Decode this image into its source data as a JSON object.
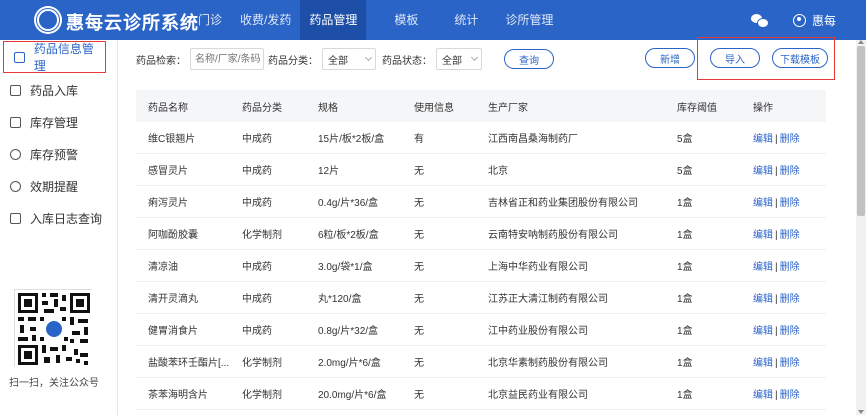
{
  "app": {
    "title": "惠每云诊所系统"
  },
  "nav": [
    {
      "label": "门诊"
    },
    {
      "label": "收费/发药"
    },
    {
      "label": "药品管理"
    },
    {
      "label": "模板"
    },
    {
      "label": "统计"
    },
    {
      "label": "诊所管理"
    }
  ],
  "header_right": {
    "user_name": "惠每"
  },
  "sidebar": {
    "items": [
      {
        "label": "药品信息管理",
        "icon": "file-icon"
      },
      {
        "label": "药品入库",
        "icon": "inbox-icon"
      },
      {
        "label": "库存管理",
        "icon": "box-icon"
      },
      {
        "label": "库存预警",
        "icon": "bell-icon"
      },
      {
        "label": "效期提醒",
        "icon": "clock-icon"
      },
      {
        "label": "入库日志查询",
        "icon": "log-icon"
      }
    ],
    "qr_caption": "扫一扫，关注公众号"
  },
  "toolbar": {
    "search_label": "药品检索：",
    "search_placeholder": "名称/厂家/条码",
    "category_label": "药品分类：",
    "category_value": "全部",
    "status_label": "药品状态：",
    "status_value": "全部",
    "query_button": "查询",
    "add_button": "新增",
    "import_button": "导入",
    "download_button": "下载模板"
  },
  "table": {
    "headers": [
      "药品名称",
      "药品分类",
      "规格",
      "使用信息",
      "生产厂家",
      "库存阈值",
      "操作"
    ],
    "rows": [
      [
        "维C银翘片",
        "中成药",
        "15片/板*2板/盒",
        "有",
        "江西南昌桑海制药厂",
        "5盒"
      ],
      [
        "感冒灵片",
        "中成药",
        "12片",
        "无",
        "北京",
        "5盒"
      ],
      [
        "痢泻灵片",
        "中成药",
        "0.4g/片*36/盒",
        "无",
        "吉林省正和药业集团股份有限公司",
        "1盒"
      ],
      [
        "阿咖酚胶囊",
        "化学制剂",
        "6粒/板*2板/盒",
        "无",
        "云南特安呐制药股份有限公司",
        "1盒"
      ],
      [
        "清凉油",
        "中成药",
        "3.0g/袋*1/盒",
        "无",
        "上海中华药业有限公司",
        "1盒"
      ],
      [
        "清开灵滴丸",
        "中成药",
        "丸*120/盒",
        "无",
        "江苏正大清江制药有限公司",
        "1盒"
      ],
      [
        "健胃消食片",
        "中成药",
        "0.8g/片*32/盒",
        "无",
        "江中药业股份有限公司",
        "1盒"
      ],
      [
        "盐酸苯环壬酯片[...",
        "化学制剂",
        "2.0mg/片*6/盒",
        "无",
        "北京华素制药股份有限公司",
        "1盒"
      ],
      [
        "茶苯海明含片",
        "化学制剂",
        "20.0mg/片*6/盒",
        "无",
        "北京益民药业有限公司",
        "1盒"
      ]
    ],
    "op_edit": "编辑",
    "op_sep": "|",
    "op_delete": "删除"
  }
}
